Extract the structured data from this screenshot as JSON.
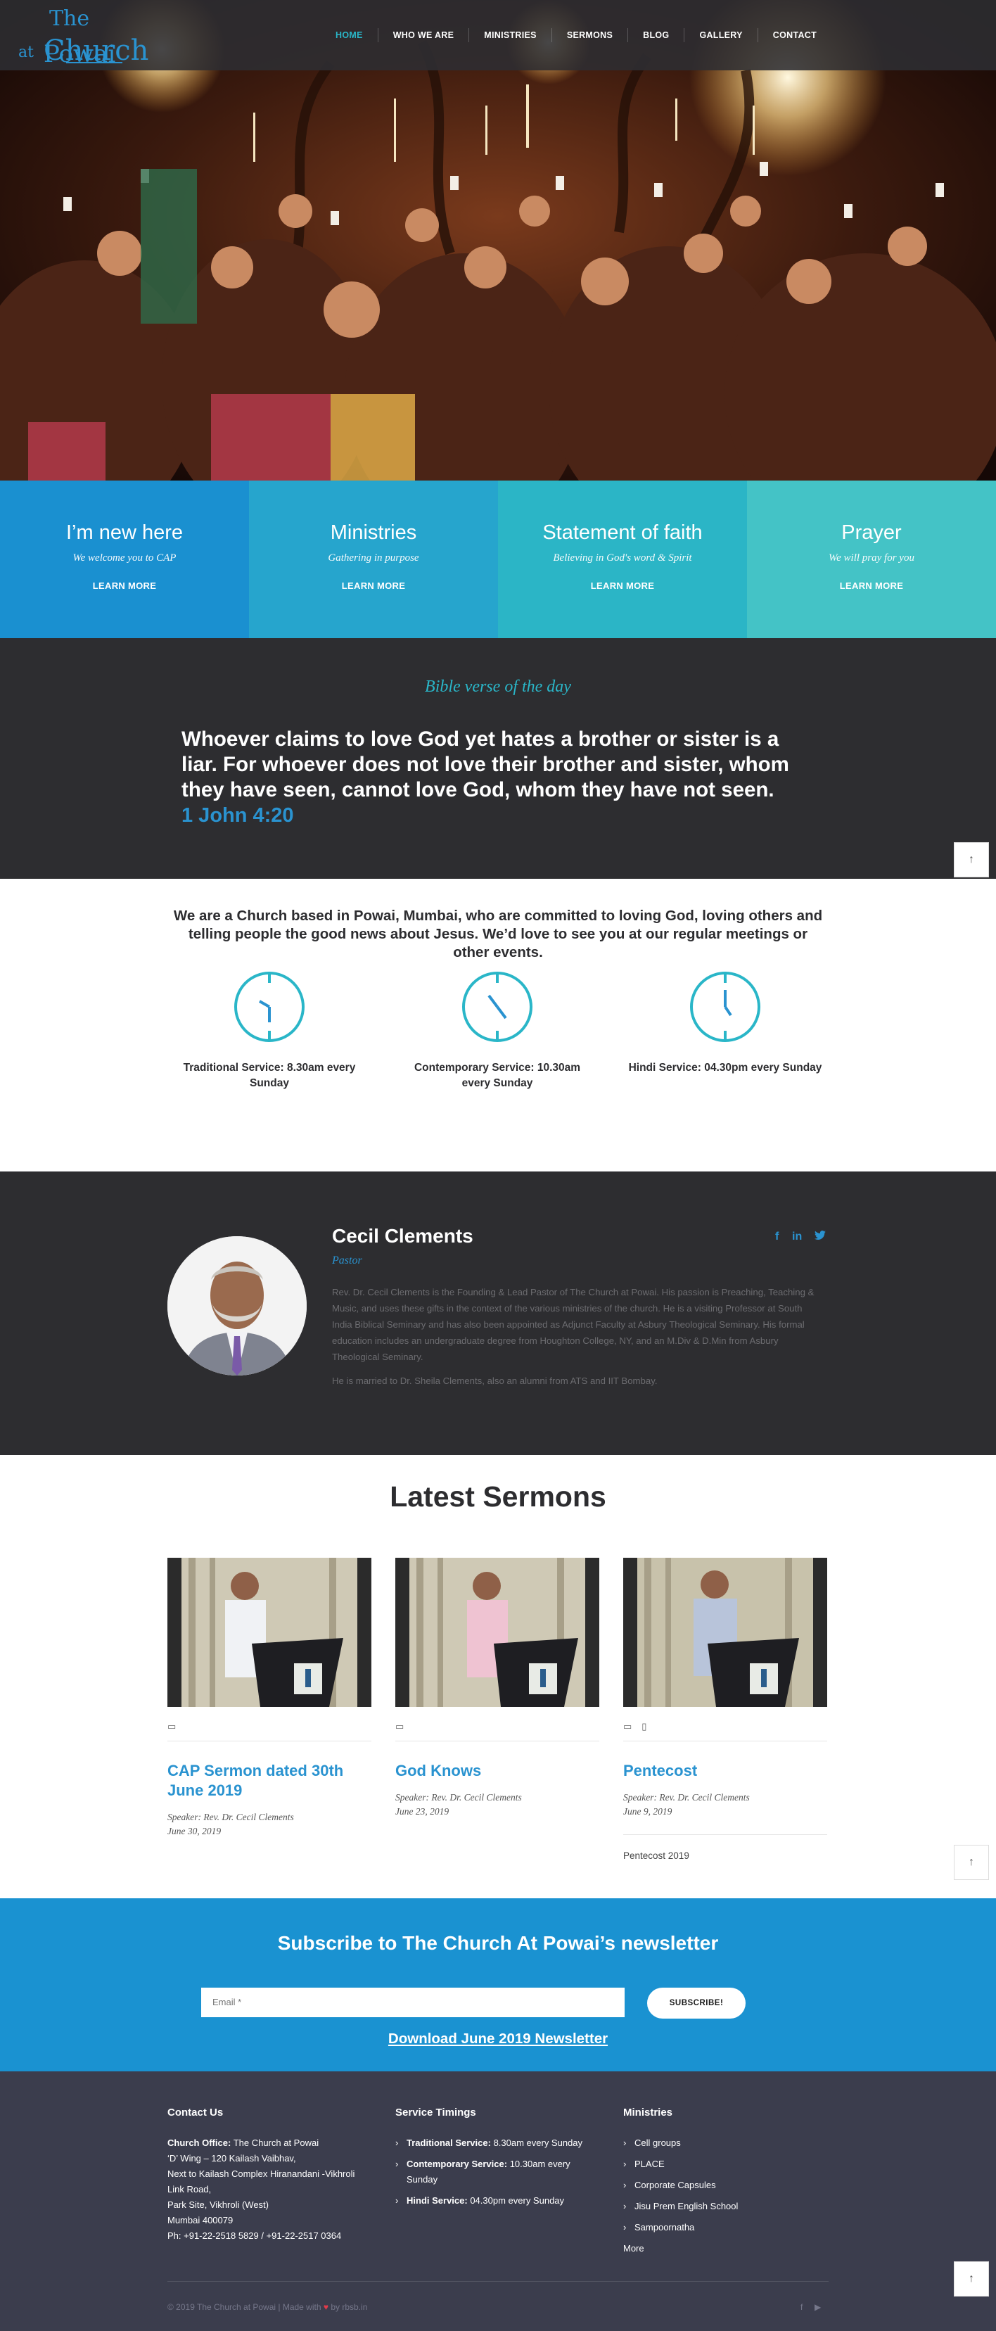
{
  "site": {
    "logo_text_1": "The",
    "logo_text_2": "Church",
    "logo_text_3": "at",
    "logo_text_4": "Powai"
  },
  "nav": {
    "items": [
      "HOME",
      "WHO WE ARE",
      "MINISTRIES",
      "SERMONS",
      "BLOG",
      "GALLERY",
      "CONTACT"
    ],
    "active": "HOME"
  },
  "tiles": [
    {
      "title": "I’m new here",
      "sub": "We welcome you to CAP",
      "more": "LEARN MORE",
      "color": "#1a90d0"
    },
    {
      "title": "Ministries",
      "sub": "Gathering in purpose",
      "more": "LEARN MORE",
      "color": "#26a5cd"
    },
    {
      "title": "Statement of faith",
      "sub": "Believing in God's word & Spirit",
      "more": "LEARN MORE",
      "color": "#2bb5c6"
    },
    {
      "title": "Prayer",
      "sub": "We will pray for you",
      "more": "LEARN MORE",
      "color": "#44c3c6"
    }
  ],
  "verse": {
    "heading": "Bible verse of the day",
    "text": "Whoever claims to love God yet hates a brother or sister is a liar. For whoever does not love their brother and sister, whom they have seen, cannot love God, whom they have not seen.",
    "ref": "1 John 4:20"
  },
  "about": {
    "intro": "We are a Church based in Powai, Mumbai, who are committed to loving God, loving others and telling people the good news about Jesus. We’d love to see you at our regular meetings or other events.",
    "services": [
      {
        "label": "Traditional Service: 8.30am every Sunday"
      },
      {
        "label": "Contemporary Service: 10.30am every Sunday"
      },
      {
        "label": "Hindi Service: 04.30pm every Sunday"
      }
    ]
  },
  "pastor": {
    "name": "Cecil Clements",
    "role": "Pastor",
    "social": [
      "f",
      "in",
      "twitter"
    ],
    "bio": "Rev. Dr. Cecil Clements is the Founding & Lead Pastor of The Church at Powai. His passion is Preaching, Teaching & Music, and uses these gifts in the context of the various ministries of the church. He is a visiting Professor at South India Biblical Seminary and has also been appointed as Adjunct Faculty at Asbury Theological Seminary. His formal education includes an undergraduate degree from Houghton College, NY, and an M.Div & D.Min from Asbury Theological Seminary.",
    "bio2": "He is married to Dr. Sheila Clements, also an alumni from ATS and IIT Bombay."
  },
  "sermons": {
    "heading": "Latest Sermons",
    "items": [
      {
        "title": "CAP Sermon dated 30th June 2019",
        "speaker": "Speaker: Rev. Dr. Cecil Clements",
        "date": "June 30, 2019",
        "extra": ""
      },
      {
        "title": "God Knows",
        "speaker": "Speaker: Rev. Dr. Cecil Clements",
        "date": "June 23, 2019",
        "extra": ""
      },
      {
        "title": "Pentecost",
        "speaker": "Speaker: Rev. Dr. Cecil Clements",
        "date": "June 9, 2019",
        "extra": "Pentecost 2019"
      }
    ]
  },
  "newsletter": {
    "heading": "Subscribe to The Church At Powai’s newsletter",
    "placeholder": "Email *",
    "button": "SUBSCRIBE!",
    "download": "Download June 2019 Newsletter"
  },
  "footer": {
    "contact_title": "Contact Us",
    "office_label": "Church Office:",
    "office_line1": "The Church at Powai",
    "address": [
      "‘D’ Wing – 120 Kailash Vaibhav,",
      "Next to Kailash Complex Hiranandani -Vikhroli Link Road,",
      "Park Site, Vikhroli (West)",
      "Mumbai 400079",
      "Ph: +91-22-2518 5829 / +91-22-2517 0364"
    ],
    "timings_title": "Service Timings",
    "timings": [
      {
        "label": "Traditional Service:",
        "value": "8.30am every Sunday"
      },
      {
        "label": "Contemporary Service:",
        "value": "10.30am every Sunday"
      },
      {
        "label": "Hindi Service:",
        "value": "04.30pm every Sunday"
      }
    ],
    "ministries_title": "Ministries",
    "ministries": [
      "Cell groups",
      "PLACE",
      "Corporate Capsules",
      "Jisu Prem English School",
      "Sampoornatha"
    ],
    "more": "More",
    "copyright_pre": "© 2019 The Church at Powai | Made with",
    "copyright_post": "by rbsb.in",
    "social": [
      "f",
      "youtube"
    ]
  },
  "colors": {
    "accent": "#2a93d0",
    "teal": "#2ab6c8",
    "dark": "#2d2d30",
    "footer": "#3b3d4d"
  }
}
